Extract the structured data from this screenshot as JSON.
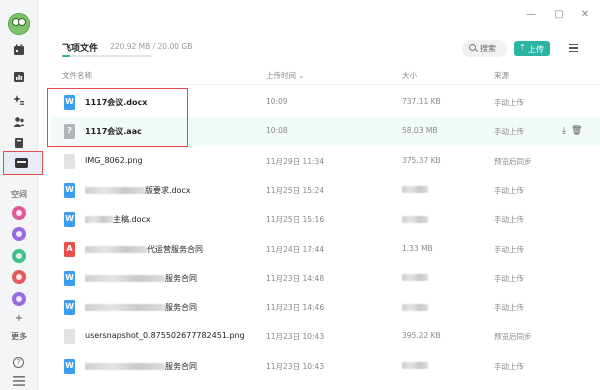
{
  "sidebar": {
    "spaces_label": "空间",
    "more_label": "更多",
    "more_plus": "+",
    "help_glyph": "?",
    "space_colors": [
      "#e05a9a",
      "#9a6be0",
      "#3fbf8a",
      "#e05a5a",
      "#9a6be0"
    ]
  },
  "window": {
    "minimize": "—",
    "maximize": "□",
    "close": "✕"
  },
  "header": {
    "title": "飞项文件",
    "storage": "220.92 MB / 20.00 GB",
    "storage_used_fraction": 0.011,
    "search_label": "搜索",
    "upload_label": "上传",
    "upload_arrow": "⇡"
  },
  "columns": {
    "name": "文件名称",
    "time": "上传时间",
    "time_sort": "⌄",
    "size": "大小",
    "source": "来源"
  },
  "files": [
    {
      "type": "doc",
      "color": "#3b9cf0",
      "glyph": "W",
      "name": "1117会议.docx",
      "time": "10:09",
      "size": "737.11 KB",
      "source": "手动上传"
    },
    {
      "type": "audio",
      "color": "#b0b4ba",
      "glyph": "?",
      "name": "1117会议.aac",
      "time": "10:08",
      "size": "58.03 MB",
      "source": "手动上传"
    },
    {
      "type": "image",
      "color": "#e2e2e2",
      "glyph": "",
      "name": "IMG_8062.png",
      "time": "11月29日 11:34",
      "size": "375.37 KB",
      "source": "预览后同步"
    },
    {
      "type": "doc",
      "color": "#3b9cf0",
      "glyph": "W",
      "name": "版要求.docx",
      "time": "11月25日 15:24",
      "size": "",
      "source": "手动上传"
    },
    {
      "type": "doc",
      "color": "#3b9cf0",
      "glyph": "W",
      "name": "主稿.docx",
      "time": "11月25日 15:16",
      "size": "",
      "source": "手动上传"
    },
    {
      "type": "pdf",
      "color": "#e8524a",
      "glyph": "A",
      "name": "代运营服务合同",
      "time": "11月24日 17:44",
      "size": "1.33 MB",
      "source": "手动上传"
    },
    {
      "type": "doc",
      "color": "#3b9cf0",
      "glyph": "W",
      "name": "服务合同",
      "time": "11月23日 14:48",
      "size": "",
      "source": "手动上传"
    },
    {
      "type": "doc",
      "color": "#3b9cf0",
      "glyph": "W",
      "name": "服务合同",
      "time": "11月23日 14:46",
      "size": "",
      "source": "手动上传"
    },
    {
      "type": "image",
      "color": "#e2e2e2",
      "glyph": "",
      "name": "usersnapshot_0.875502677782451.png",
      "time": "11月23日 10:43",
      "size": "395.22 KB",
      "source": "预览后同步"
    },
    {
      "type": "doc",
      "color": "#3b9cf0",
      "glyph": "W",
      "name": "服务合同",
      "time": "11月23日 10:43",
      "size": "",
      "source": "手动上传"
    }
  ],
  "row_actions": {
    "download": "⤓",
    "delete": "🗑"
  }
}
